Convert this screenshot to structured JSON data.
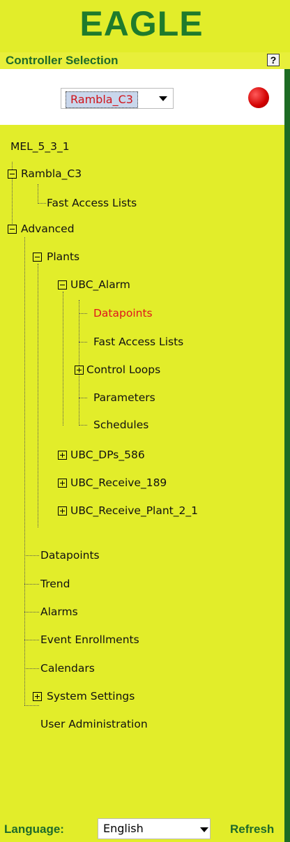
{
  "app": {
    "logo_text": "EAGLE"
  },
  "controller": {
    "title": "Controller Selection",
    "help_label": "?",
    "selected": "Rambla_C3",
    "status_color": "#e00000"
  },
  "tree": {
    "root": "MEL_5_3_1",
    "rambla": "Rambla_C3",
    "rambla_fast": "Fast Access Lists",
    "advanced": "Advanced",
    "plants": "Plants",
    "ubc_alarm": "UBC_Alarm",
    "alarm_datapoints": "Datapoints",
    "alarm_fast": "Fast Access Lists",
    "alarm_control_loops": "Control Loops",
    "alarm_parameters": "Parameters",
    "alarm_schedules": "Schedules",
    "ubc_dps": "UBC_DPs_586",
    "ubc_receive": "UBC_Receive_189",
    "ubc_receive_plant": "UBC_Receive_Plant_2_1",
    "datapoints": "Datapoints",
    "trend": "Trend",
    "alarms": "Alarms",
    "event_enrollments": "Event Enrollments",
    "calendars": "Calendars",
    "system_settings": "System Settings",
    "user_admin": "User Administration"
  },
  "footer": {
    "language_label": "Language:",
    "language_value": "English",
    "refresh_label": "Refresh"
  },
  "colors": {
    "background": "#e2ed2a",
    "brand_green": "#1f7b2c",
    "selected_red": "#e0161c"
  }
}
